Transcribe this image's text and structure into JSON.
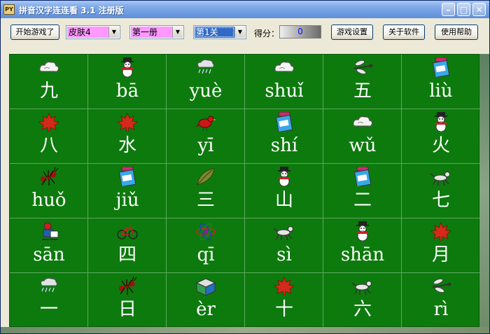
{
  "window": {
    "title": "拼音汉字连连看 3.1 注册版",
    "minimize_glyph": "–",
    "maximize_glyph": "□",
    "close_glyph": "✕",
    "app_icon_text": "PY"
  },
  "toolbar": {
    "start_label": "开始游戏了",
    "skin_value": "皮肤4",
    "volume_value": "第一册",
    "level_value": "第1关",
    "score_label": "得分：",
    "score_value": "0",
    "settings_label": "游戏设置",
    "about_label": "关于软件",
    "help_label": "使用帮助"
  },
  "board": {
    "rows": [
      [
        {
          "text": "九",
          "icon": "cloud-icon"
        },
        {
          "text": "bā",
          "icon": "snowman-icon"
        },
        {
          "text": "yuè",
          "icon": "rain-icon"
        },
        {
          "text": "shuǐ",
          "icon": "cloud-icon"
        },
        {
          "text": "五",
          "icon": "dragonfly-icon"
        },
        {
          "text": "liù",
          "icon": "drink-bottle-icon"
        }
      ],
      [
        {
          "text": "八",
          "icon": "maple-leaf-icon"
        },
        {
          "text": "水",
          "icon": "maple-leaf-icon"
        },
        {
          "text": "yī",
          "icon": "bird-icon"
        },
        {
          "text": "shí",
          "icon": "drink-bottle-icon"
        },
        {
          "text": "wǔ",
          "icon": "cloud-icon"
        },
        {
          "text": "火",
          "icon": "snowman-icon"
        }
      ],
      [
        {
          "text": "huǒ",
          "icon": "ant-icon"
        },
        {
          "text": "jiǔ",
          "icon": "drink-bottle-icon"
        },
        {
          "text": "三",
          "icon": "leaf-icon"
        },
        {
          "text": "山",
          "icon": "snowman-icon"
        },
        {
          "text": "二",
          "icon": "drink-bottle-icon"
        },
        {
          "text": "七",
          "icon": "dog-icon"
        }
      ],
      [
        {
          "text": "sān",
          "icon": "reader-icon"
        },
        {
          "text": "四",
          "icon": "bicycle-icon"
        },
        {
          "text": "qī",
          "icon": "atom-icon"
        },
        {
          "text": "sì",
          "icon": "dog-icon"
        },
        {
          "text": "shān",
          "icon": "snowman-icon"
        },
        {
          "text": "月",
          "icon": "maple-leaf-icon"
        }
      ],
      [
        {
          "text": "一",
          "icon": "rain-icon"
        },
        {
          "text": "日",
          "icon": "ant-icon"
        },
        {
          "text": "èr",
          "icon": "book-icon"
        },
        {
          "text": "十",
          "icon": "maple-leaf-icon"
        },
        {
          "text": "六",
          "icon": "dog-icon"
        },
        {
          "text": "rì",
          "icon": "dragonfly-icon"
        }
      ]
    ]
  }
}
